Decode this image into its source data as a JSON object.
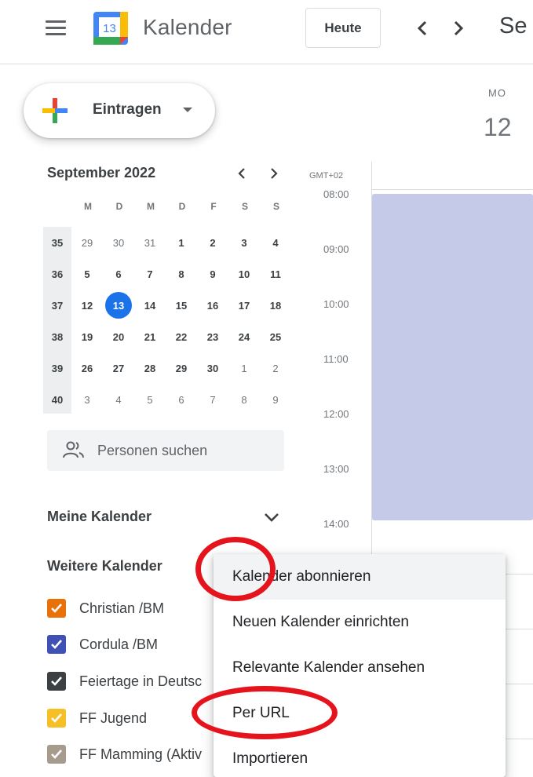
{
  "header": {
    "app_title": "Kalender",
    "logo_day": "13",
    "today_button": "Heute",
    "month_label": "Se"
  },
  "create": {
    "label": "Eintragen"
  },
  "mini_calendar": {
    "title": "September 2022",
    "weekdays": [
      "M",
      "D",
      "M",
      "D",
      "F",
      "S",
      "S"
    ],
    "rows": [
      {
        "week": "35",
        "days": [
          "29",
          "30",
          "31",
          "1",
          "2",
          "3",
          "4"
        ]
      },
      {
        "week": "36",
        "days": [
          "5",
          "6",
          "7",
          "8",
          "9",
          "10",
          "11"
        ]
      },
      {
        "week": "37",
        "days": [
          "12",
          "13",
          "14",
          "15",
          "16",
          "17",
          "18"
        ]
      },
      {
        "week": "38",
        "days": [
          "19",
          "20",
          "21",
          "22",
          "23",
          "24",
          "25"
        ]
      },
      {
        "week": "39",
        "days": [
          "26",
          "27",
          "28",
          "29",
          "30",
          "1",
          "2"
        ]
      },
      {
        "week": "40",
        "days": [
          "3",
          "4",
          "5",
          "6",
          "7",
          "8",
          "9"
        ]
      }
    ],
    "selected_day": "13"
  },
  "people_search": {
    "placeholder": "Personen suchen"
  },
  "my_calendars": {
    "title": "Meine Kalender"
  },
  "other_calendars": {
    "title": "Weitere Kalender",
    "items": [
      {
        "name": "Christian /BM",
        "color": "#e8710a"
      },
      {
        "name": "Cordula /BM",
        "color": "#3f51b5"
      },
      {
        "name": "Feiertage in Deutsc",
        "color": "#3c4043"
      },
      {
        "name": "FF Jugend",
        "color": "#f6bf26"
      },
      {
        "name": "FF Mamming (Aktiv",
        "color": "#a79b8e"
      }
    ]
  },
  "day_view": {
    "timezone": "GMT+02",
    "day_name": "MO",
    "day_number": "12",
    "times": [
      "08:00",
      "09:00",
      "10:00",
      "11:00",
      "12:00",
      "13:00",
      "14:00"
    ],
    "event_color": "#c5cae9"
  },
  "context_menu": {
    "items": [
      "Kalender abonnieren",
      "Neuen Kalender einrichten",
      "Relevante Kalender ansehen",
      "Per URL",
      "Importieren"
    ]
  },
  "annotation_color": "#e5141c"
}
